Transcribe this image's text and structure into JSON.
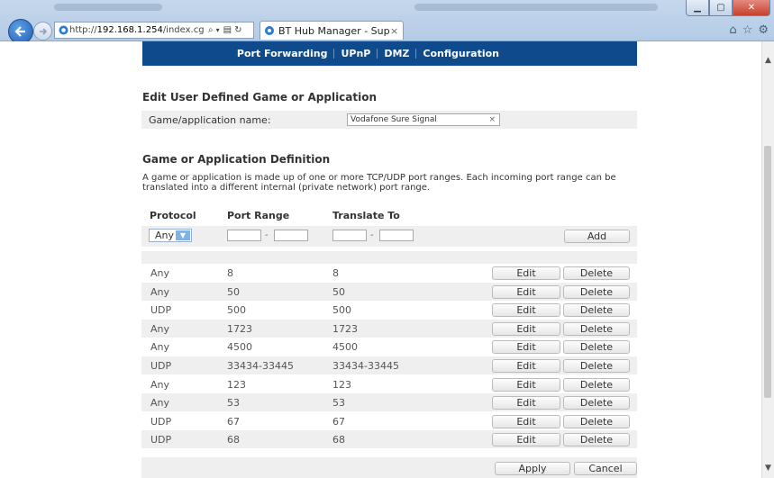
{
  "browser": {
    "url_prefix": "http://",
    "url_host": "192.168.1.254",
    "url_path": "/index.cgi?act",
    "tab_title": "BT Hub Manager - Support...",
    "tab_close": "×"
  },
  "nav": {
    "items": [
      "Port Forwarding",
      "UPnP",
      "DMZ",
      "Configuration"
    ]
  },
  "edit": {
    "heading": "Edit User Defined Game or Application",
    "name_label": "Game/application name:",
    "name_value": "Vodafone Sure Signal",
    "name_clear": "×"
  },
  "definition": {
    "heading": "Game or Application Definition",
    "description": "A game or application is made up of one or more TCP/UDP port ranges. Each incoming port range can be translated into a different internal (private network) port range."
  },
  "table": {
    "headers": {
      "protocol": "Protocol",
      "port_range": "Port Range",
      "translate_to": "Translate To"
    },
    "add_row": {
      "protocol": "Any",
      "dash": "-",
      "add_label": "Add"
    },
    "edit_label": "Edit",
    "delete_label": "Delete",
    "rows": [
      {
        "protocol": "Any",
        "port_range": "8",
        "translate_to": "8"
      },
      {
        "protocol": "Any",
        "port_range": "50",
        "translate_to": "50"
      },
      {
        "protocol": "UDP",
        "port_range": "500",
        "translate_to": "500"
      },
      {
        "protocol": "Any",
        "port_range": "1723",
        "translate_to": "1723"
      },
      {
        "protocol": "Any",
        "port_range": "4500",
        "translate_to": "4500"
      },
      {
        "protocol": "UDP",
        "port_range": "33434-33445",
        "translate_to": "33434-33445"
      },
      {
        "protocol": "Any",
        "port_range": "123",
        "translate_to": "123"
      },
      {
        "protocol": "Any",
        "port_range": "53",
        "translate_to": "53"
      },
      {
        "protocol": "UDP",
        "port_range": "67",
        "translate_to": "67"
      },
      {
        "protocol": "UDP",
        "port_range": "68",
        "translate_to": "68"
      }
    ]
  },
  "footer": {
    "apply_label": "Apply",
    "cancel_label": "Cancel"
  },
  "colors": {
    "nav_bg": "#0f4a8c",
    "row_alt": "#efefef"
  }
}
